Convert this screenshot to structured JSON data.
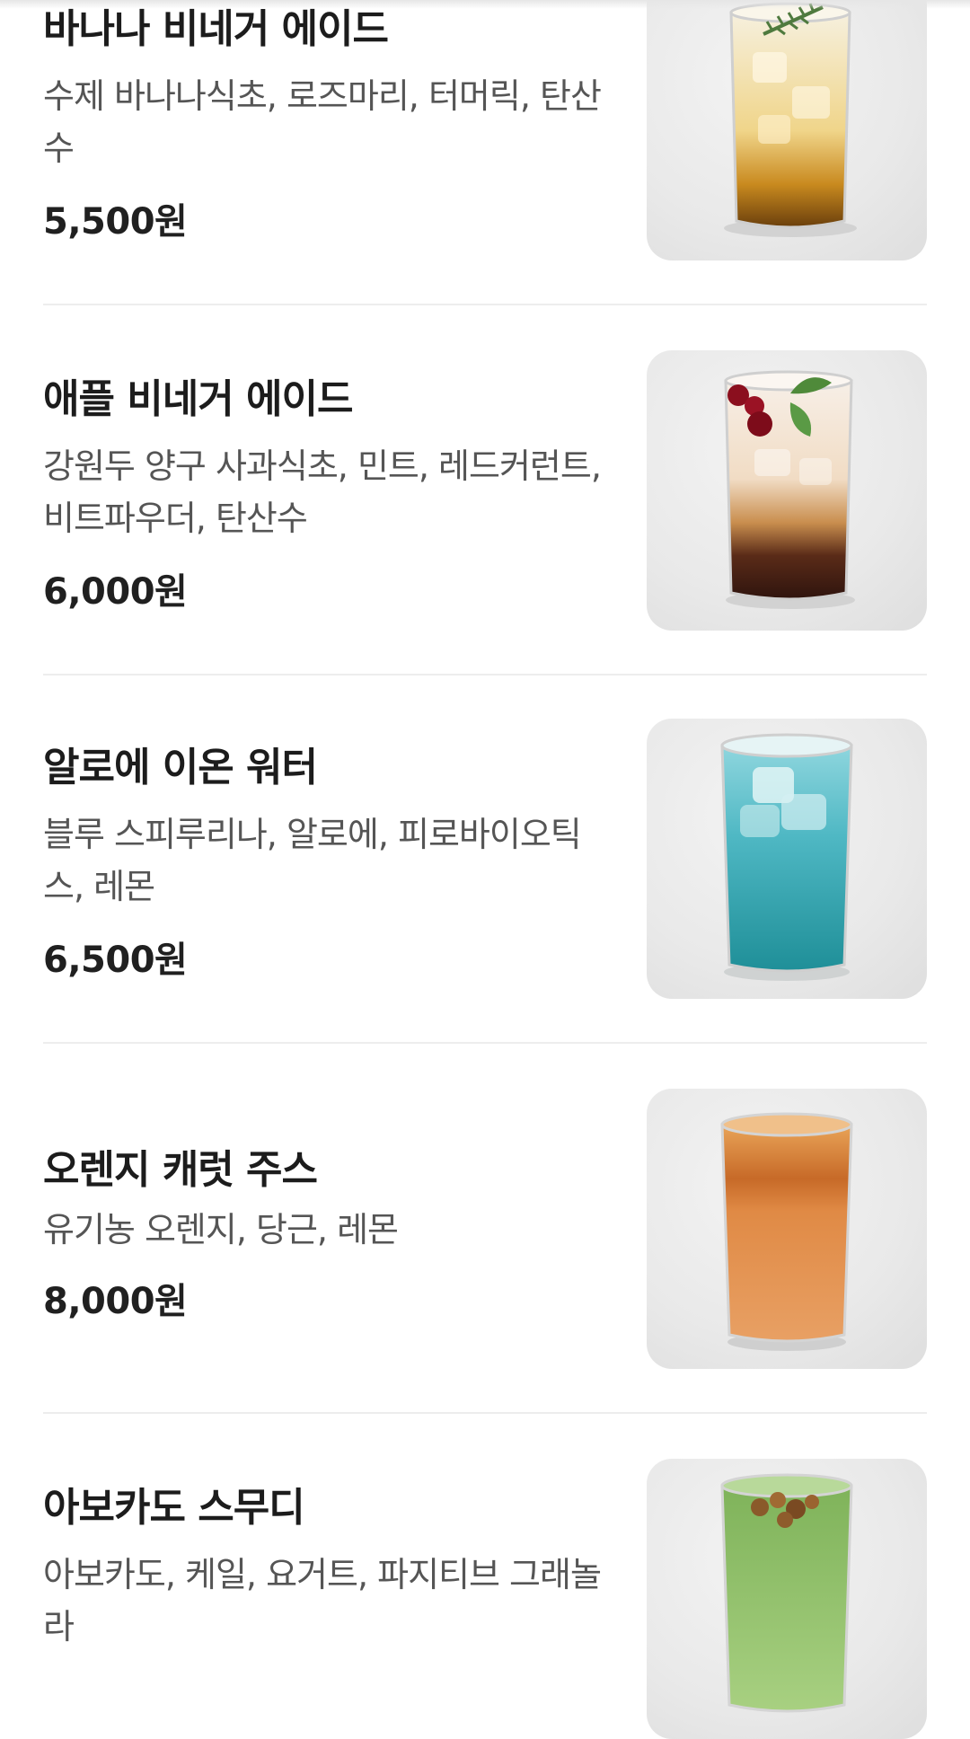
{
  "menu": {
    "items": [
      {
        "name": "바나나 비네거 에이드",
        "description": "수제 바나나식초, 로즈마리, 터머릭, 탄산수",
        "price": "5,500원",
        "photo_icon": "drink-photo",
        "drink_colors": {
          "top": "#f3e6c0",
          "bottom": "#8a5410"
        }
      },
      {
        "name": "애플 비네거 에이드",
        "description": "강원두 양구 사과식초, 민트, 레드커런트, 비트파우더, 탄산수",
        "price": "6,000원",
        "photo_icon": "drink-photo",
        "drink_colors": {
          "top": "#f3e6d6",
          "bottom": "#3a1c12"
        }
      },
      {
        "name": "알로에 이온 워터",
        "description": "블루 스피루리나, 알로에, 피로바이오틱스, 레몬",
        "price": "6,500원",
        "photo_icon": "drink-photo",
        "drink_colors": {
          "top": "#5fc2cf",
          "bottom": "#1b8c94"
        }
      },
      {
        "name": "오렌지 캐럿 주스",
        "description": "유기농 오렌지, 당근, 레몬",
        "price": "8,000원",
        "photo_icon": "drink-photo",
        "drink_colors": {
          "top": "#e08a3c",
          "bottom": "#e49a5a"
        }
      },
      {
        "name": "아보카도 스무디",
        "description": "아보카도, 케일, 요거트, 파지티브 그래놀라",
        "price": "",
        "photo_icon": "drink-photo",
        "drink_colors": {
          "top": "#8fc26a",
          "bottom": "#a6cf7e"
        }
      }
    ]
  }
}
